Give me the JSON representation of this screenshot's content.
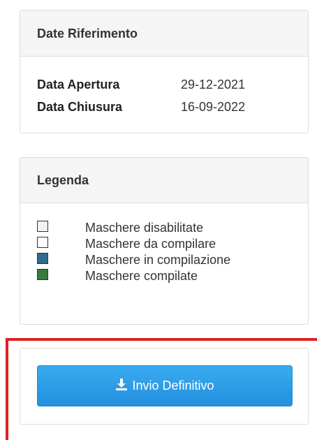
{
  "dates_panel": {
    "title": "Date Riferimento",
    "rows": [
      {
        "label": "Data Apertura",
        "value": "29-12-2021"
      },
      {
        "label": "Data Chiusura",
        "value": "16-09-2022"
      }
    ]
  },
  "legend_panel": {
    "title": "Legenda",
    "items": [
      {
        "label": "Maschere disabilitate",
        "color": "#f2f2f2"
      },
      {
        "label": "Maschere da compilare",
        "color": "#ffffff"
      },
      {
        "label": "Maschere in compilazione",
        "color": "#2e6d8e"
      },
      {
        "label": "Maschere compilate",
        "color": "#3a7a3e"
      }
    ]
  },
  "submit_panel": {
    "button_label": "Invio Definitivo",
    "button_icon": "download-icon"
  },
  "colors": {
    "highlight": "#e02020",
    "button": "#2a9be6"
  }
}
